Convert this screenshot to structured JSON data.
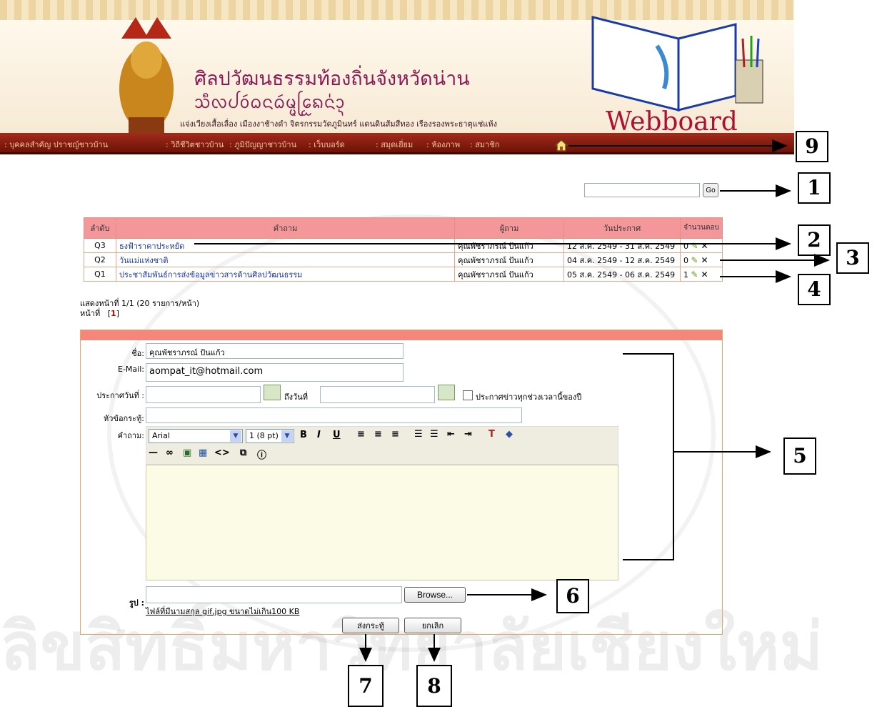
{
  "header": {
    "title_thai": "ศิลปวัฒนธรรมท้องถิ่นจังหวัดน่าน",
    "title_script": "ᩈᩥᩃᨸᩅᩢᨵᨶᨵᩢᨾᩜᩕᩮᩬᨦᨶ᩵ᩣ᩠ᨶ",
    "tagline": "แจ่งเวียงเสื้อเลื่อง เมืองงาช้างดำ จิตรกรรมวัดภูมินทร์ แดนดินส้มสีทอง เรืองรองพระธาตุแช่แห้ง",
    "logo_word": "Webboard",
    "nav": [
      ": บุคคลสำคัญ ปราชญ์ชาวบ้าน",
      ": วิถีชีวิตชาวบ้าน",
      ": ภูมิปัญญาชาวบ้าน",
      ": เว็บบอร์ด",
      ": สมุดเยี่ยม",
      ": ห้องภาพ",
      ": สมาชิก"
    ],
    "home_icon": "home-icon"
  },
  "search": {
    "go_label": "Go"
  },
  "table": {
    "headers": [
      "ลำดับ",
      "คำถาม",
      "ผู้ถาม",
      "วันประกาศ",
      "จำนวนตอบ"
    ],
    "rows": [
      {
        "id": "Q3",
        "topic": "ธงฟ้าราคาประหยัด",
        "author": "คุณพัชราภรณ์ ปันแก้ว",
        "dates": "12 ส.ค. 2549 - 31 ส.ค. 2549",
        "replies": "0"
      },
      {
        "id": "Q2",
        "topic": "วันแม่แห่งชาติ",
        "author": "คุณพัชราภรณ์ ปันแก้ว",
        "dates": "04 ส.ค. 2549 - 12 ส.ค. 2549",
        "replies": "0"
      },
      {
        "id": "Q1",
        "topic": "ประชาสัมพันธ์การส่งข้อมูลข่าวสารด้านศิลปวัฒนธรรม",
        "author": "คุณพัชราภรณ์ ปันแก้ว",
        "dates": "05 ส.ค. 2549 - 06 ส.ค. 2549",
        "replies": "1"
      }
    ],
    "edit_icon": "edit-icon",
    "delete_icon": "delete-icon"
  },
  "paging": {
    "line1": "แสดงหน้าที่ 1/1 (20 รายการ/หน้า)",
    "prefix": "หน้าที่",
    "open": "[",
    "current": "1",
    "close": "]"
  },
  "form": {
    "name_label": "ชื่อ:",
    "name_value": "คุณพัชราภรณ์ ปันแก้ว",
    "email_label": "E-Mail:",
    "email_value": "aompat_it@hotmail.com",
    "date_from_label": "ประกาศวันที่ :",
    "date_to_label": "ถึงวันที่",
    "all_year_label": "ประกาศข่าวทุกช่วงเวลานี้ของปี",
    "subject_label": "หัวข้อกระทู้:",
    "question_label": "คำถาม:",
    "font_value": "Arial",
    "size_value": "1 (8 pt)",
    "image_label": "รูป :",
    "browse_label": "Browse...",
    "file_note": "ไฟล์ที่มีนามสกุล gif,jpg ขนาดไม่เกิน100 KB",
    "submit_label": "ส่งกระทู้",
    "cancel_label": "ยกเลิก"
  },
  "callouts": [
    "9",
    "1",
    "2",
    "3",
    "4",
    "5",
    "6",
    "7",
    "8"
  ]
}
